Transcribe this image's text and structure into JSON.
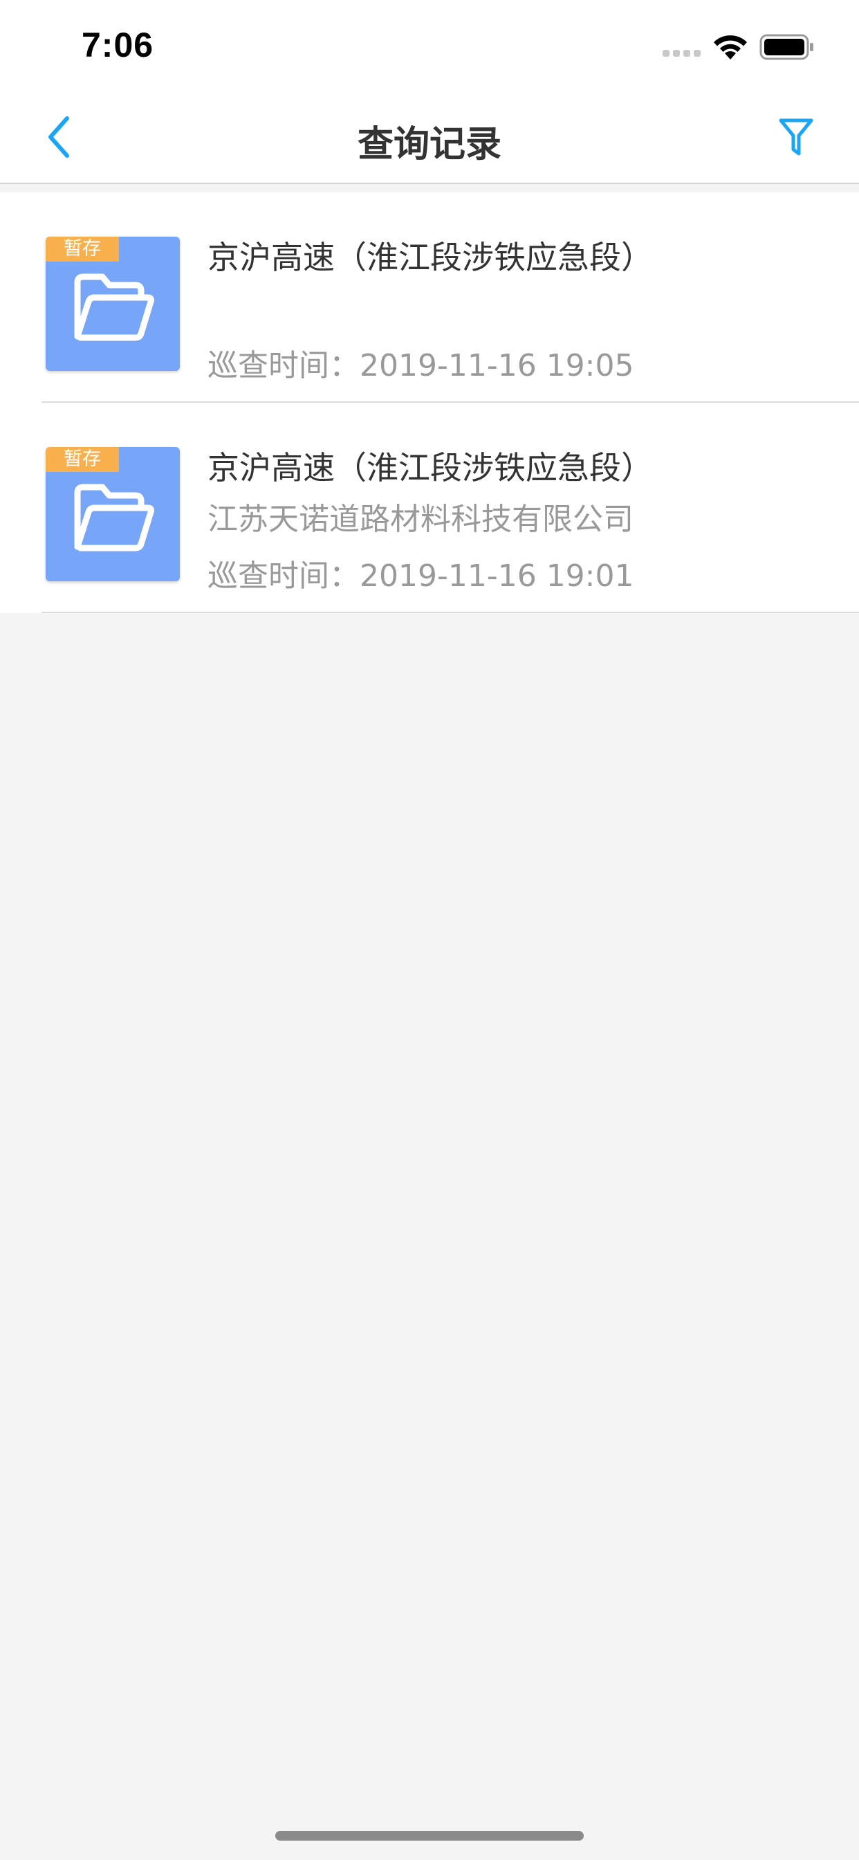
{
  "status_bar": {
    "time": "7:06",
    "icons": [
      "signal-icon",
      "wifi-icon",
      "battery-icon"
    ]
  },
  "nav": {
    "title": "查询记录",
    "back_icon": "chevron-left-icon",
    "filter_icon": "filter-icon"
  },
  "colors": {
    "accent": "#1aa6f5",
    "thumbnail": "#77a5f7",
    "badge": "#f8b04c",
    "title_text": "#333333",
    "secondary_text": "#999999",
    "background": "#f4f4f4"
  },
  "records": [
    {
      "badge": "暂存",
      "title": "京沪高速（淮江段涉铁应急段）",
      "company": "",
      "time": "巡查时间：2019-11-16 19:05"
    },
    {
      "badge": "暂存",
      "title": "京沪高速（淮江段涉铁应急段）",
      "company": "江苏天诺道路材料科技有限公司",
      "time": "巡查时间：2019-11-16 19:01"
    }
  ]
}
